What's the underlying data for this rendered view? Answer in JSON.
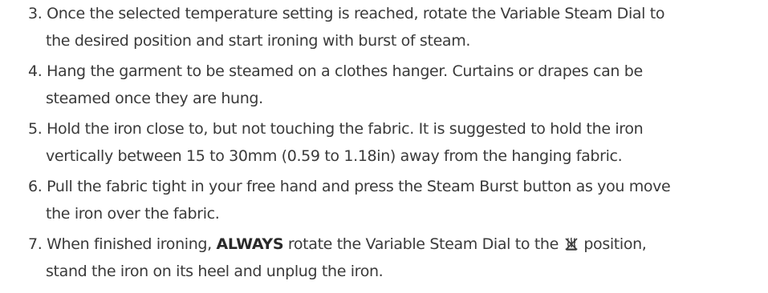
{
  "steps": [
    {
      "line1": "3. Once the selected temperature setting is reached, rotate the Variable Steam Dial to",
      "line2": "the desired position and start ironing with burst of steam."
    },
    {
      "line1": "4. Hang the garment to be steamed on a clothes hanger. Curtains or drapes can be",
      "line2": "steamed once they are hung."
    },
    {
      "line1": "5. Hold the iron close to, but not touching the fabric. It is suggested to hold the iron",
      "line2": "vertically between 15 to 30mm (0.59 to 1.18in) away from the hanging fabric."
    },
    {
      "line1": "6. Pull the fabric tight in your free hand and press the Steam Burst button as you move",
      "line2": "the iron over the fabric."
    },
    {
      "line1_before": "7. When finished ironing, ",
      "line1_emphasis": "ALWAYS",
      "line1_after_a": " rotate the Variable Steam Dial to the ",
      "line1_icon": "steam-off-icon",
      "line1_after_b": " position,",
      "line2": "stand the iron on its heel and unplug the iron."
    }
  ]
}
